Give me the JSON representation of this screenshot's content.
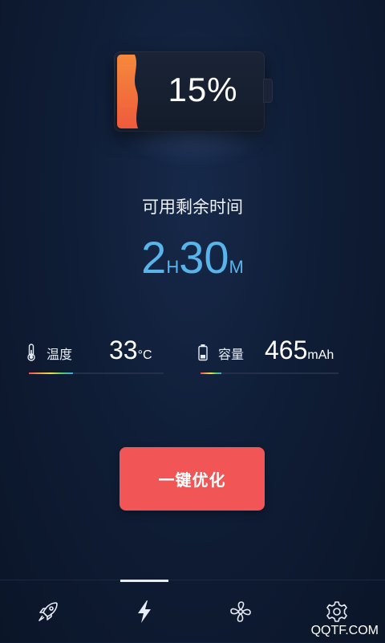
{
  "battery": {
    "percent_text": "15%",
    "level": 0.15
  },
  "remaining": {
    "label": "可用剩余时间",
    "hours": "2",
    "hours_unit": "H",
    "minutes": "30",
    "minutes_unit": "M"
  },
  "stats": {
    "temperature": {
      "label": "温度",
      "value": "33",
      "unit": "°C",
      "icon": "thermometer-icon",
      "level": 0.33
    },
    "capacity": {
      "label": "容量",
      "value": "465",
      "unit": "mAh",
      "icon": "battery-small-icon",
      "level": 0.15
    }
  },
  "optimize_button": {
    "label": "一键优化"
  },
  "bottom_nav": {
    "items": [
      {
        "icon": "rocket-icon"
      },
      {
        "icon": "lightning-icon",
        "active": true
      },
      {
        "icon": "fan-icon"
      },
      {
        "icon": "gear-icon"
      }
    ]
  },
  "watermark": "QQTF.COM",
  "colors": {
    "accent_blue": "#58b4ea",
    "button_red": "#f25555",
    "battery_orange": "#f26a3a",
    "background": "#0f1d36"
  }
}
